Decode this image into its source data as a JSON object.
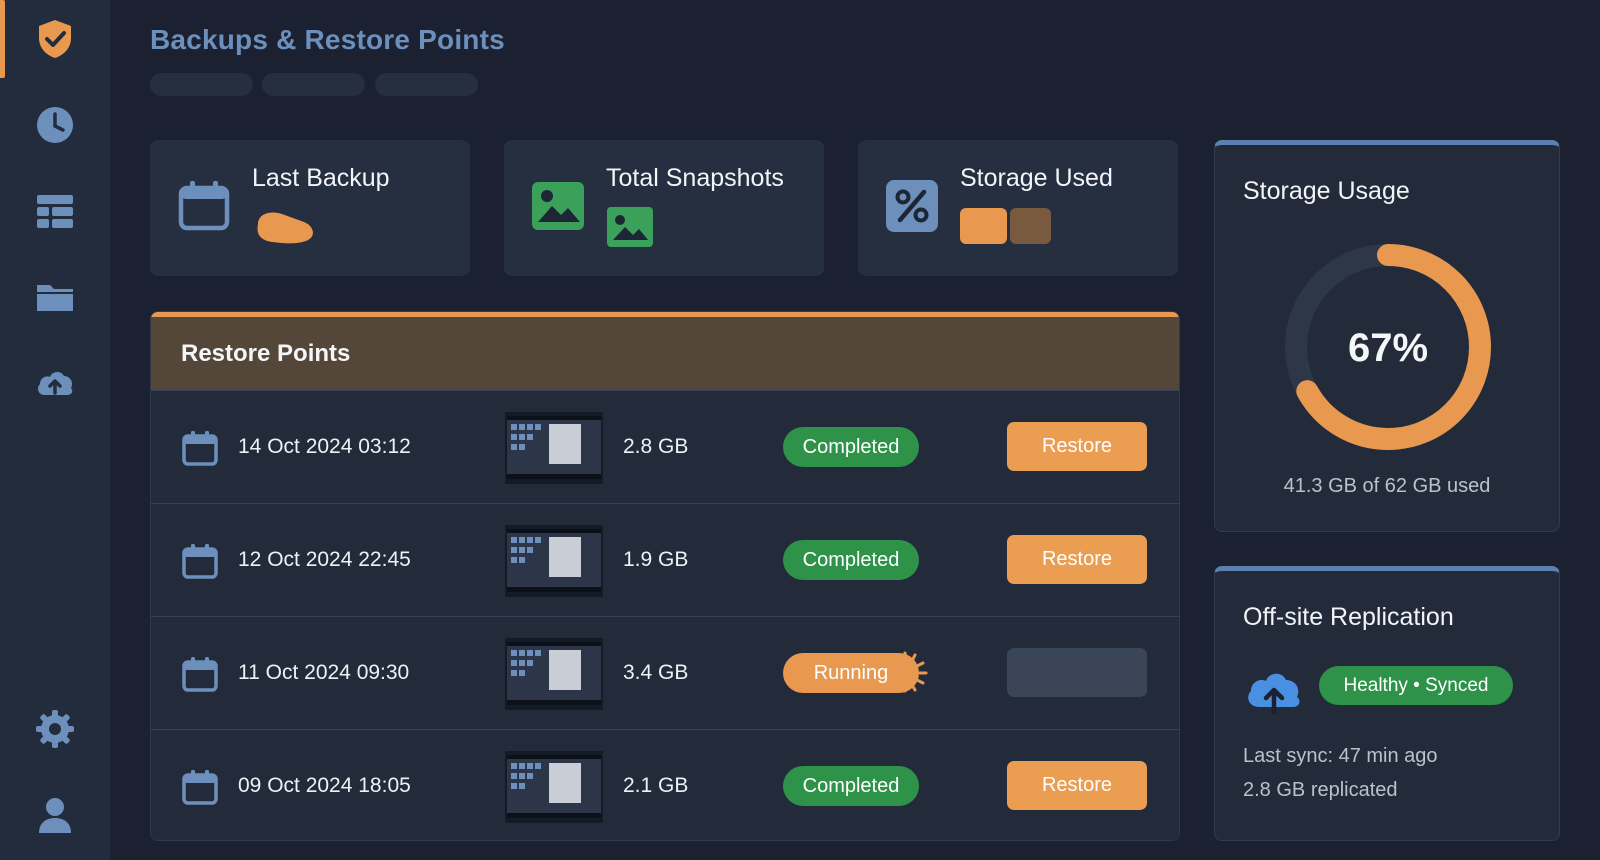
{
  "header": {
    "title": "Backups & Restore Points"
  },
  "sidebar": {
    "items": [
      {
        "icon": "shield-check-icon",
        "active": true
      },
      {
        "icon": "clock-icon",
        "active": false
      },
      {
        "icon": "server-icon",
        "active": false
      },
      {
        "icon": "folder-icon",
        "active": false
      },
      {
        "icon": "cloud-upload-icon",
        "active": false
      },
      {
        "icon": "gear-icon",
        "active": false
      },
      {
        "icon": "user-icon",
        "active": false
      }
    ]
  },
  "stats": [
    {
      "label": "Last Backup",
      "icon": "calendar-icon"
    },
    {
      "label": "Total Snapshots",
      "icon": "image-icon"
    },
    {
      "label": "Storage Used",
      "icon": "percent-icon"
    }
  ],
  "restore_points": {
    "title": "Restore Points",
    "rows": [
      {
        "date": "14 Oct 2024 03:12",
        "size": "2.8 GB",
        "status": "Completed",
        "action": "Restore"
      },
      {
        "date": "12 Oct 2024 22:45",
        "size": "1.9 GB",
        "status": "Completed",
        "action": "Restore"
      },
      {
        "date": "11 Oct 2024 09:30",
        "size": "3.4 GB",
        "status": "Running",
        "action": ""
      },
      {
        "date": "09 Oct 2024 18:05",
        "size": "2.1 GB",
        "status": "Completed",
        "action": "Restore"
      }
    ]
  },
  "storage_usage": {
    "title": "Storage Usage",
    "percent": 67,
    "percent_label": "67%",
    "caption": "41.3 GB of 62 GB used"
  },
  "replication": {
    "title": "Off-site Replication",
    "status": "Healthy • Synced",
    "last_sync": "Last sync: 47 min ago",
    "replicated": "2.8 GB replicated"
  },
  "colors": {
    "accent": "#e8994f",
    "success": "#2e9248",
    "nav_icon": "#6c8fbc",
    "background": "#1b2130"
  }
}
